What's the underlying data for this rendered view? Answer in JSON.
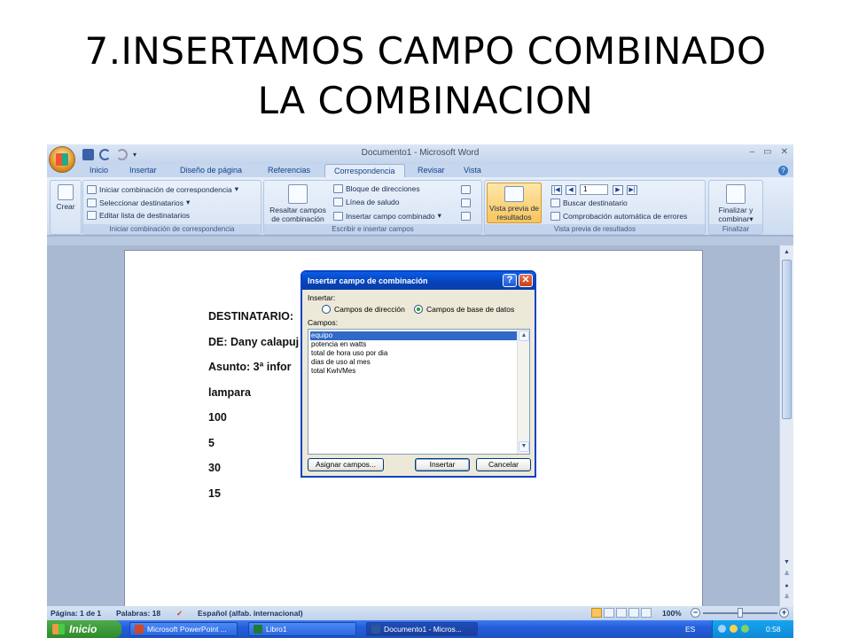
{
  "slide": {
    "title_line1": "7.INSERTAMOS CAMPO COMBINADO",
    "title_line2": "LA COMBINACION"
  },
  "window": {
    "title": "Documento1 - Microsoft Word",
    "controls": [
      "–",
      "▭",
      "✕"
    ]
  },
  "tabs": [
    {
      "label": "Inicio"
    },
    {
      "label": "Insertar"
    },
    {
      "label": "Diseño de página"
    },
    {
      "label": "Referencias"
    },
    {
      "label": "Correspondencia",
      "active": true
    },
    {
      "label": "Revisar"
    },
    {
      "label": "Vista"
    }
  ],
  "ribbon": {
    "crear": {
      "button": "Crear"
    },
    "iniciar": {
      "label": "Iniciar combinación de correspondencia",
      "items": [
        "Iniciar combinación de correspondencia",
        "Seleccionar destinatarios",
        "Editar lista de destinatarios"
      ]
    },
    "escribir": {
      "label": "Escribir e insertar campos",
      "resaltar": "Resaltar campos de combinación",
      "items": [
        "Bloque de direcciones",
        "Línea de saludo",
        "Insertar campo combinado"
      ]
    },
    "vista_previa": {
      "label": "Vista previa de resultados",
      "button": "Vista previa de resultados",
      "record": "1",
      "items": [
        "Buscar destinatario",
        "Comprobación automática de errores"
      ]
    },
    "finalizar": {
      "label": "Finalizar",
      "button": "Finalizar y combinar"
    }
  },
  "document": {
    "lines": [
      "DESTINATARIO:",
      "DE: Dany calapuj",
      "Asunto: 3ª infor",
      "lampara",
      "100",
      "5",
      "30",
      "15"
    ]
  },
  "dialog": {
    "title": "Insertar campo de combinación",
    "insertar_label": "Insertar:",
    "radio_direccion": "Campos de dirección",
    "radio_base": "Campos de base de datos",
    "campos_label": "Campos:",
    "fields": [
      "equipo",
      "potencia en watts",
      "total de hora uso por dia",
      "dias de uso al mes",
      "total Kwh/Mes"
    ],
    "selected_field": "equipo",
    "asignar": "Asignar campos...",
    "insertar": "Insertar",
    "cancelar": "Cancelar"
  },
  "statusbar": {
    "pagina": "Página: 1 de 1",
    "palabras": "Palabras: 18",
    "idioma": "Español (alfab. internacional)",
    "zoom": "100%"
  },
  "taskbar": {
    "start": "Inicio",
    "tasks": [
      "Microsoft PowerPoint ...",
      "Libro1",
      "Documento1 - Micros..."
    ],
    "lang": "ES",
    "clock": "0:58"
  },
  "colors": {
    "xp_title_blue": "#0a5ce6",
    "ribbon_tab_text": "#15428b",
    "selection": "#316ac5"
  }
}
